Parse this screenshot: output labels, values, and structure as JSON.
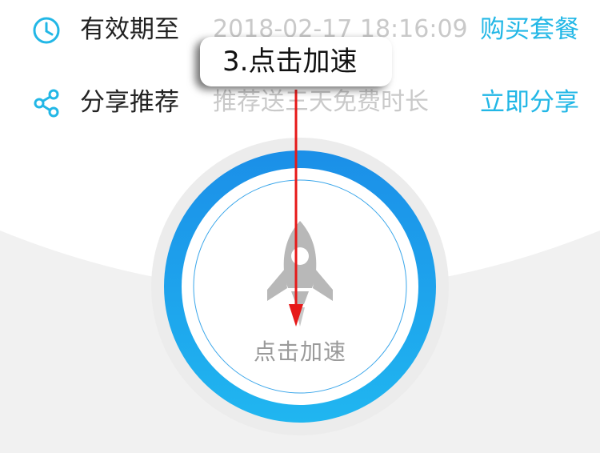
{
  "expiry": {
    "label": "有效期至",
    "value": "2018-02-17 18:16:09",
    "action": "购买套餐"
  },
  "share": {
    "label": "分享推荐",
    "value": "推荐送三天免费时长",
    "action": "立即分享"
  },
  "boost": {
    "label": "点击加速"
  },
  "annotation": {
    "text": "3.点击加速"
  },
  "colors": {
    "accent": "#22b7e6",
    "ring_top": "#1b8fe8",
    "ring_bottom": "#20b6f0",
    "annotation_arrow": "#e61919",
    "rocket": "#b8b8b8"
  }
}
